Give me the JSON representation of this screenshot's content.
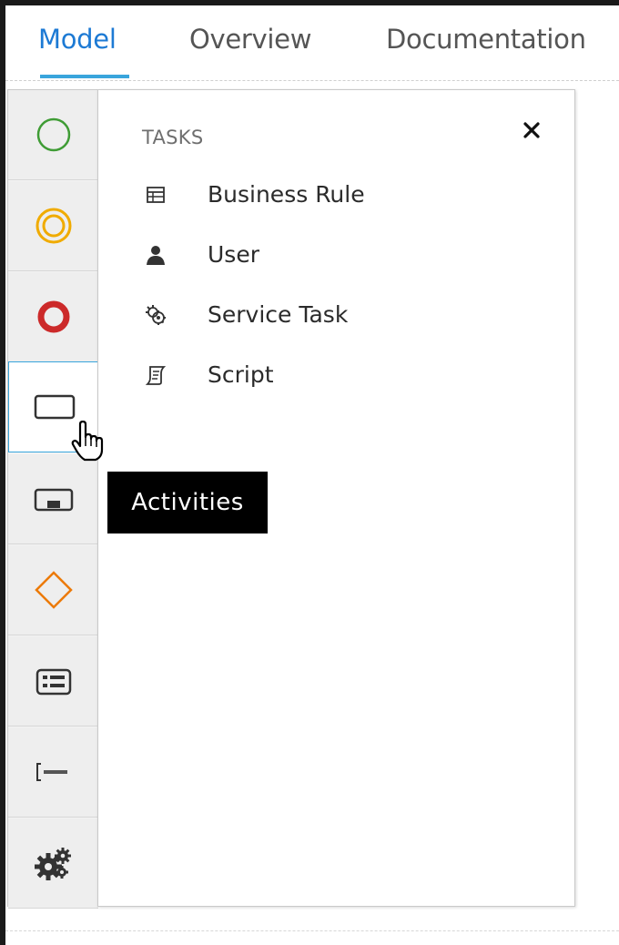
{
  "tabs": [
    {
      "label": "Model",
      "active": true
    },
    {
      "label": "Overview",
      "active": false
    },
    {
      "label": "Documentation",
      "active": false
    }
  ],
  "palette": {
    "items": [
      {
        "name": "start-events",
        "icon": "green-circle-icon"
      },
      {
        "name": "intermediate-events",
        "icon": "double-circle-icon"
      },
      {
        "name": "end-events",
        "icon": "red-thick-circle-icon"
      },
      {
        "name": "activities",
        "icon": "task-rectangle-icon",
        "selected": true
      },
      {
        "name": "subprocesses",
        "icon": "subprocess-icon"
      },
      {
        "name": "gateways",
        "icon": "diamond-icon"
      },
      {
        "name": "containers",
        "icon": "list-box-icon"
      },
      {
        "name": "artifacts",
        "icon": "text-annotation-icon"
      },
      {
        "name": "custom-tasks",
        "icon": "gears-icon"
      }
    ]
  },
  "panel": {
    "title": "TASKS",
    "close_symbol": "×",
    "tasks": [
      {
        "label": "Business Rule",
        "icon": "table-icon"
      },
      {
        "label": "User",
        "icon": "user-icon"
      },
      {
        "label": "Service Task",
        "icon": "gear-icon"
      },
      {
        "label": "Script",
        "icon": "script-icon"
      }
    ]
  },
  "tooltip": {
    "text": "Activities"
  },
  "colors": {
    "accent": "#39a5dc",
    "active_tab": "#1d7ad4",
    "start_event": "#3f9c35",
    "intermediate_event": "#f0ab00",
    "end_event": "#cc2a2a",
    "gateway": "#ec7a08"
  }
}
